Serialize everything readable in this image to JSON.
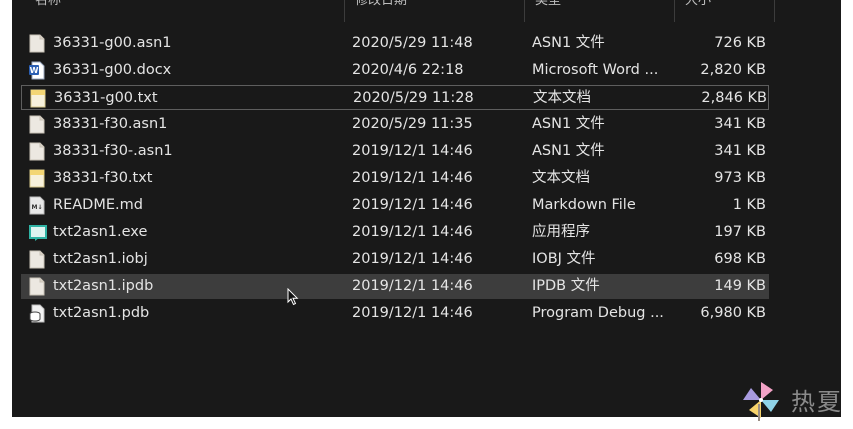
{
  "columns": [
    {
      "label": "名称"
    },
    {
      "label": "修改日期"
    },
    {
      "label": "类型"
    },
    {
      "label": "大小"
    }
  ],
  "files": [
    {
      "name": "36331-g00.asn1",
      "date": "2020/5/29 11:48",
      "type": "ASN1 文件",
      "size": "726 KB",
      "icon": "generic-file-icon"
    },
    {
      "name": "36331-g00.docx",
      "date": "2020/4/6 22:18",
      "type": "Microsoft Word ...",
      "size": "2,820 KB",
      "icon": "word-doc-icon"
    },
    {
      "name": "36331-g00.txt",
      "date": "2020/5/29 11:28",
      "type": "文本文档",
      "size": "2,846 KB",
      "icon": "text-file-icon"
    },
    {
      "name": "38331-f30.asn1",
      "date": "2020/5/29 11:35",
      "type": "ASN1 文件",
      "size": "341 KB",
      "icon": "generic-file-icon"
    },
    {
      "name": "38331-f30-.asn1",
      "date": "2019/12/1 14:46",
      "type": "ASN1 文件",
      "size": "341 KB",
      "icon": "generic-file-icon"
    },
    {
      "name": "38331-f30.txt",
      "date": "2019/12/1 14:46",
      "type": "文本文档",
      "size": "973 KB",
      "icon": "text-file-icon"
    },
    {
      "name": "README.md",
      "date": "2019/12/1 14:46",
      "type": "Markdown File",
      "size": "1 KB",
      "icon": "markdown-file-icon"
    },
    {
      "name": "txt2asn1.exe",
      "date": "2019/12/1 14:46",
      "type": "应用程序",
      "size": "197 KB",
      "icon": "executable-icon"
    },
    {
      "name": "txt2asn1.iobj",
      "date": "2019/12/1 14:46",
      "type": "IOBJ 文件",
      "size": "698 KB",
      "icon": "generic-file-icon"
    },
    {
      "name": "txt2asn1.ipdb",
      "date": "2019/12/1 14:46",
      "type": "IPDB 文件",
      "size": "149 KB",
      "icon": "generic-file-icon"
    },
    {
      "name": "txt2asn1.pdb",
      "date": "2019/12/1 14:46",
      "type": "Program Debug ...",
      "size": "6,980 KB",
      "icon": "debug-database-icon"
    }
  ],
  "state": {
    "focused_row_index": 2,
    "hovered_row_index": 9
  },
  "watermark": {
    "text": "热夏"
  },
  "colors": {
    "background": "#191919",
    "text": "#e4e4e4",
    "hover": "#3d3d3d",
    "focus_border": "#5e5e5e",
    "word_blue": "#2b5fb3",
    "text_file_yellow": "#f3d675",
    "exe_teal": "#2fb3a4"
  }
}
